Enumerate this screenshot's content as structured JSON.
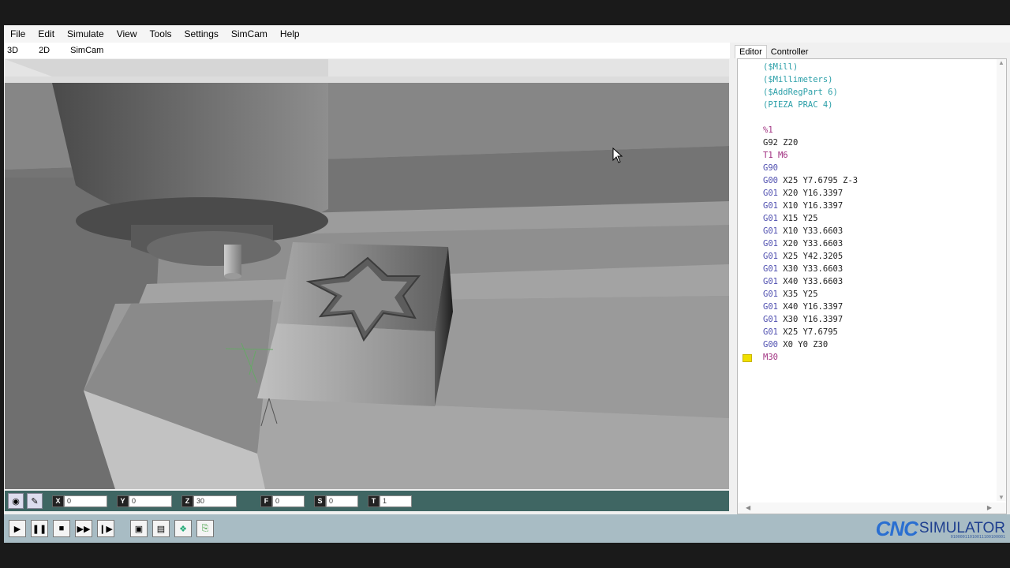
{
  "menu": [
    "File",
    "Edit",
    "Simulate",
    "View",
    "Tools",
    "Settings",
    "SimCam",
    "Help"
  ],
  "view_tabs": [
    "3D",
    "2D",
    "SimCam"
  ],
  "right_tabs": [
    "Editor",
    "Controller"
  ],
  "coords": {
    "x": {
      "label": "X",
      "value": "0"
    },
    "y": {
      "label": "Y",
      "value": "0"
    },
    "z": {
      "label": "Z",
      "value": "30"
    },
    "f": {
      "label": "F",
      "value": "0"
    },
    "s": {
      "label": "S",
      "value": "0"
    },
    "t": {
      "label": "T",
      "value": "1"
    }
  },
  "code": [
    {
      "parts": [
        {
          "t": "($Mill)",
          "c": "comment"
        }
      ]
    },
    {
      "parts": [
        {
          "t": "($Millimeters)",
          "c": "comment"
        }
      ]
    },
    {
      "parts": [
        {
          "t": "($AddRegPart 6)",
          "c": "comment"
        }
      ]
    },
    {
      "parts": [
        {
          "t": "(PIEZA PRAC 4)",
          "c": "comment"
        }
      ]
    },
    {
      "parts": []
    },
    {
      "parts": [
        {
          "t": "%1",
          "c": "m"
        }
      ]
    },
    {
      "parts": [
        {
          "t": "G92 ",
          "c": "num"
        },
        {
          "t": "Z20",
          "c": "num"
        }
      ]
    },
    {
      "parts": [
        {
          "t": "T1 ",
          "c": "m"
        },
        {
          "t": "M6",
          "c": "m"
        }
      ]
    },
    {
      "parts": [
        {
          "t": "G90",
          "c": "g"
        }
      ]
    },
    {
      "parts": [
        {
          "t": "G00 ",
          "c": "g"
        },
        {
          "t": "X25 Y7.6795 Z-3",
          "c": "num"
        }
      ]
    },
    {
      "parts": [
        {
          "t": "G01 ",
          "c": "g"
        },
        {
          "t": "X20 Y16.3397",
          "c": "num"
        }
      ]
    },
    {
      "parts": [
        {
          "t": "G01 ",
          "c": "g"
        },
        {
          "t": "X10 Y16.3397",
          "c": "num"
        }
      ]
    },
    {
      "parts": [
        {
          "t": "G01 ",
          "c": "g"
        },
        {
          "t": "X15 Y25",
          "c": "num"
        }
      ]
    },
    {
      "parts": [
        {
          "t": "G01 ",
          "c": "g"
        },
        {
          "t": "X10 Y33.6603",
          "c": "num"
        }
      ]
    },
    {
      "parts": [
        {
          "t": "G01 ",
          "c": "g"
        },
        {
          "t": "X20 Y33.6603",
          "c": "num"
        }
      ]
    },
    {
      "parts": [
        {
          "t": "G01 ",
          "c": "g"
        },
        {
          "t": "X25 Y42.3205",
          "c": "num"
        }
      ]
    },
    {
      "parts": [
        {
          "t": "G01 ",
          "c": "g"
        },
        {
          "t": "X30 Y33.6603",
          "c": "num"
        }
      ]
    },
    {
      "parts": [
        {
          "t": "G01 ",
          "c": "g"
        },
        {
          "t": "X40 Y33.6603",
          "c": "num"
        }
      ]
    },
    {
      "parts": [
        {
          "t": "G01 ",
          "c": "g"
        },
        {
          "t": "X35 Y25",
          "c": "num"
        }
      ]
    },
    {
      "parts": [
        {
          "t": "G01 ",
          "c": "g"
        },
        {
          "t": "X40 Y16.3397",
          "c": "num"
        }
      ]
    },
    {
      "parts": [
        {
          "t": "G01 ",
          "c": "g"
        },
        {
          "t": "X30 Y16.3397",
          "c": "num"
        }
      ]
    },
    {
      "parts": [
        {
          "t": "G01 ",
          "c": "g"
        },
        {
          "t": "X25 Y7.6795",
          "c": "num"
        }
      ]
    },
    {
      "parts": [
        {
          "t": "G00 ",
          "c": "g"
        },
        {
          "t": "X0 Y0 Z30",
          "c": "num"
        }
      ]
    },
    {
      "parts": [
        {
          "t": "M30",
          "c": "m"
        }
      ],
      "marker": true
    }
  ],
  "playback": [
    "play-button",
    "pause-button",
    "stop-button",
    "fast-forward-button",
    "step-button"
  ],
  "tools": [
    "zoom-fit-button",
    "view-button",
    "render-button",
    "export-button"
  ],
  "logo": {
    "cnc": "CNC",
    "simulator": "SIMULATOR",
    "bits": "01000011010011100100001"
  },
  "colors": {
    "viewport_bg": "#8a8a8a",
    "coordbar": "#3f6663",
    "bottombar": "#a8bcc4"
  }
}
